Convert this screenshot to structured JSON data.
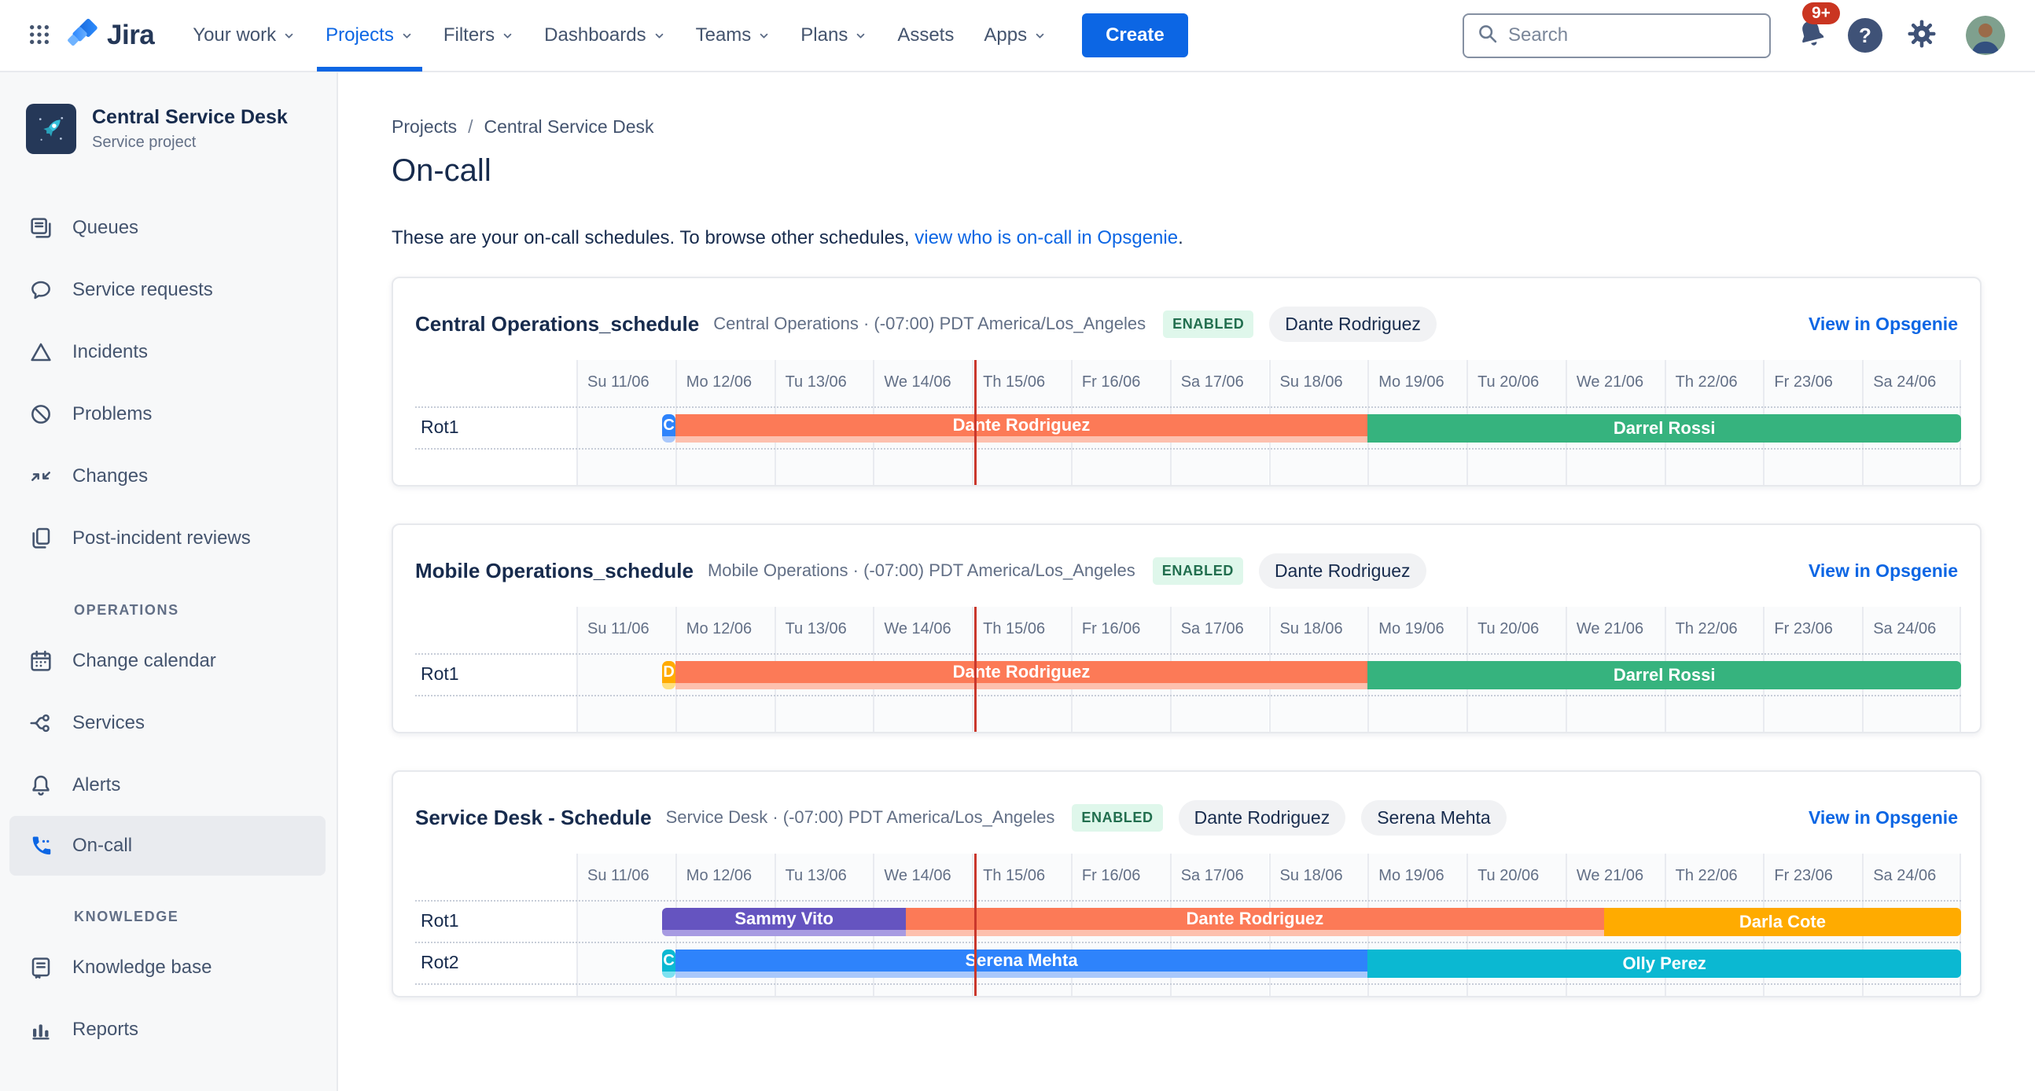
{
  "colors": {
    "accent": "#0C66E4",
    "now_line": "#C9372C",
    "status_bg": "#DFF7EB",
    "status_text": "#216E4E",
    "notification_badge": "#CA3521"
  },
  "nav": {
    "items": [
      {
        "label": "Your work",
        "chevron": true,
        "active": false
      },
      {
        "label": "Projects",
        "chevron": true,
        "active": true
      },
      {
        "label": "Filters",
        "chevron": true,
        "active": false
      },
      {
        "label": "Dashboards",
        "chevron": true,
        "active": false
      },
      {
        "label": "Teams",
        "chevron": true,
        "active": false
      },
      {
        "label": "Plans",
        "chevron": true,
        "active": false
      },
      {
        "label": "Assets",
        "chevron": false,
        "active": false
      },
      {
        "label": "Apps",
        "chevron": true,
        "active": false
      }
    ],
    "app_name": "Jira",
    "create_label": "Create",
    "search_placeholder": "Search",
    "notification_count": "9+"
  },
  "sidebar": {
    "project_name": "Central Service Desk",
    "project_type": "Service project",
    "groups": [
      {
        "title": "",
        "items": [
          {
            "label": "Queues",
            "icon": "queues-icon"
          },
          {
            "label": "Service requests",
            "icon": "service-requests-icon"
          },
          {
            "label": "Incidents",
            "icon": "incidents-icon"
          },
          {
            "label": "Problems",
            "icon": "problems-icon"
          },
          {
            "label": "Changes",
            "icon": "changes-icon"
          },
          {
            "label": "Post-incident reviews",
            "icon": "post-incident-reviews-icon"
          }
        ]
      },
      {
        "title": "OPERATIONS",
        "items": [
          {
            "label": "Change calendar",
            "icon": "change-calendar-icon"
          },
          {
            "label": "Services",
            "icon": "services-icon"
          },
          {
            "label": "Alerts",
            "icon": "alerts-icon"
          },
          {
            "label": "On-call",
            "icon": "on-call-icon",
            "selected": true
          }
        ]
      },
      {
        "title": "KNOWLEDGE",
        "items": [
          {
            "label": "Knowledge base",
            "icon": "knowledge-base-icon"
          },
          {
            "label": "Reports",
            "icon": "reports-icon"
          }
        ]
      }
    ]
  },
  "breadcrumb": {
    "items": [
      "Projects",
      "Central Service Desk"
    ],
    "separator": "/"
  },
  "page": {
    "title": "On-call",
    "description_text": "These are your on-call schedules. To browse other schedules, ",
    "description_link": "view who is on-call in Opsgenie",
    "description_suffix": "."
  },
  "timeline": {
    "days": [
      "Su 11/06",
      "Mo 12/06",
      "Tu 13/06",
      "We 14/06",
      "Th 15/06",
      "Fr 16/06",
      "Sa 17/06",
      "Su 18/06",
      "Mo 19/06",
      "Tu 20/06",
      "We 21/06",
      "Th 22/06",
      "Fr 23/06",
      "Sa 24/06"
    ],
    "now_day": 4.03
  },
  "schedules": [
    {
      "name": "Central Operations_schedule",
      "meta": "Central Operations · (-07:00) PDT America/Los_Angeles",
      "status": "ENABLED",
      "people": [
        "Dante Rodriguez"
      ],
      "link_label": "View in Opsgenie",
      "rotations": [
        {
          "label": "Rot1",
          "bars": [
            {
              "text": "C",
              "start": 0.87,
              "end": 1.0,
              "color": "#2E83FB",
              "light": "#A9C8FB",
              "chip": true
            },
            {
              "text": "Dante Rodriguez",
              "start": 1.0,
              "end": 8.0,
              "color": "#FC7A57",
              "light": "#FDC0AE"
            },
            {
              "text": "Darrel Rossi",
              "start": 8.0,
              "end": 14.0,
              "color": "#36B37E"
            }
          ]
        }
      ]
    },
    {
      "name": "Mobile Operations_schedule",
      "meta": "Mobile Operations · (-07:00) PDT America/Los_Angeles",
      "status": "ENABLED",
      "people": [
        "Dante Rodriguez"
      ],
      "link_label": "View in Opsgenie",
      "rotations": [
        {
          "label": "Rot1",
          "bars": [
            {
              "text": "D",
              "start": 0.87,
              "end": 1.0,
              "color": "#FFAB00",
              "light": "#FFE07E",
              "chip": true
            },
            {
              "text": "Dante Rodriguez",
              "start": 1.0,
              "end": 8.0,
              "color": "#FC7A57",
              "light": "#FDC0AE"
            },
            {
              "text": "Darrel Rossi",
              "start": 8.0,
              "end": 14.0,
              "color": "#36B37E"
            }
          ]
        }
      ]
    },
    {
      "name": "Service Desk - Schedule",
      "meta": "Service Desk · (-07:00) PDT America/Los_Angeles",
      "status": "ENABLED",
      "people": [
        "Dante Rodriguez",
        "Serena Mehta"
      ],
      "link_label": "View in Opsgenie",
      "rotations": [
        {
          "label": "Rot1",
          "bars": [
            {
              "text": "Sammy Vito",
              "start": 0.87,
              "end": 3.33,
              "color": "#6554C0",
              "light": "#A79BE2"
            },
            {
              "text": "Dante Rodriguez",
              "start": 3.33,
              "end": 10.39,
              "color": "#FC7A57",
              "light": "#FDC0AE"
            },
            {
              "text": "Darla Cote",
              "start": 10.39,
              "end": 14.0,
              "color": "#FFAB00"
            }
          ]
        },
        {
          "label": "Rot2",
          "bars": [
            {
              "text": "C",
              "start": 0.87,
              "end": 1.0,
              "color": "#0BB8D2",
              "light": "#7EE2F1",
              "chip": true
            },
            {
              "text": "Serena Mehta",
              "start": 1.0,
              "end": 8.0,
              "color": "#2E83FB",
              "light": "#A9C8FB"
            },
            {
              "text": "Olly Perez",
              "start": 8.0,
              "end": 14.0,
              "color": "#0BB8D2"
            }
          ]
        }
      ]
    }
  ]
}
